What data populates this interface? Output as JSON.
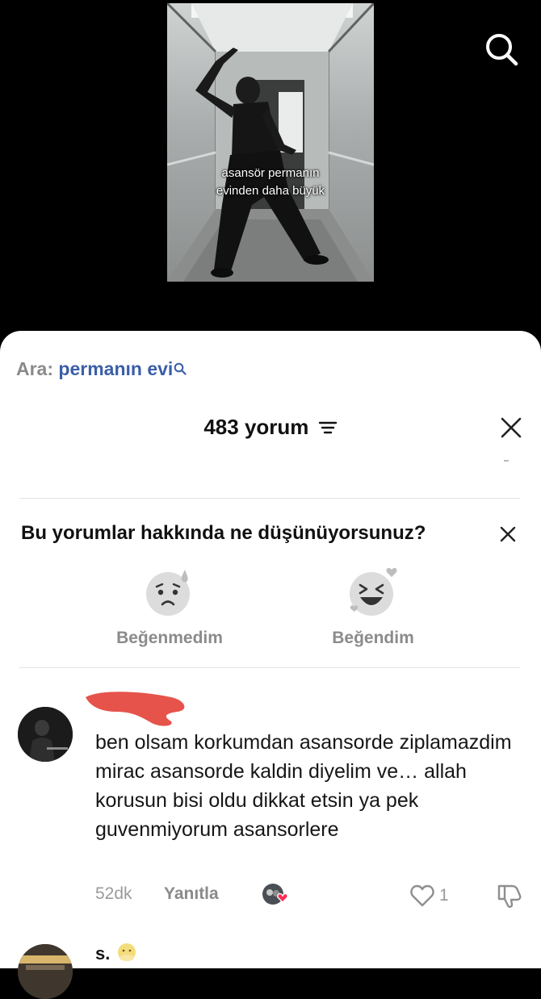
{
  "video": {
    "caption_line1": "asansör permanın",
    "caption_line2": "evinden daha büyük"
  },
  "top_bar": {
    "search_icon": "search-icon"
  },
  "search_suggestion": {
    "prefix": "Ara:",
    "query": "permanın evi",
    "icon": "search-icon"
  },
  "comments_header": {
    "count_label": "483 yorum",
    "sort_icon": "sort-icon",
    "close_icon": "close-icon"
  },
  "feedback": {
    "question": "Bu yorumlar hakkında ne düşünüyorsunuz?",
    "dislike_label": "Beğenmedim",
    "like_label": "Beğendim",
    "dislike_icon": "sad-face-icon",
    "like_icon": "laughing-face-icon"
  },
  "comments": [
    {
      "text": "ben olsam korkumdan asansorde ziplamazdim mirac asansorde kaldin diyelim ve… allah korusun bisi oldu dikkat etsin ya pek guvenmiyorum asansorlere",
      "time": "52dk",
      "reply_label": "Yanıtla",
      "likes": "1",
      "username_redacted": true
    },
    {
      "username": "s."
    }
  ],
  "colors": {
    "accent_link": "#3b5ea8",
    "muted": "#8a8a8a",
    "redaction": "#e5534b",
    "heart": "#ff2b54"
  }
}
